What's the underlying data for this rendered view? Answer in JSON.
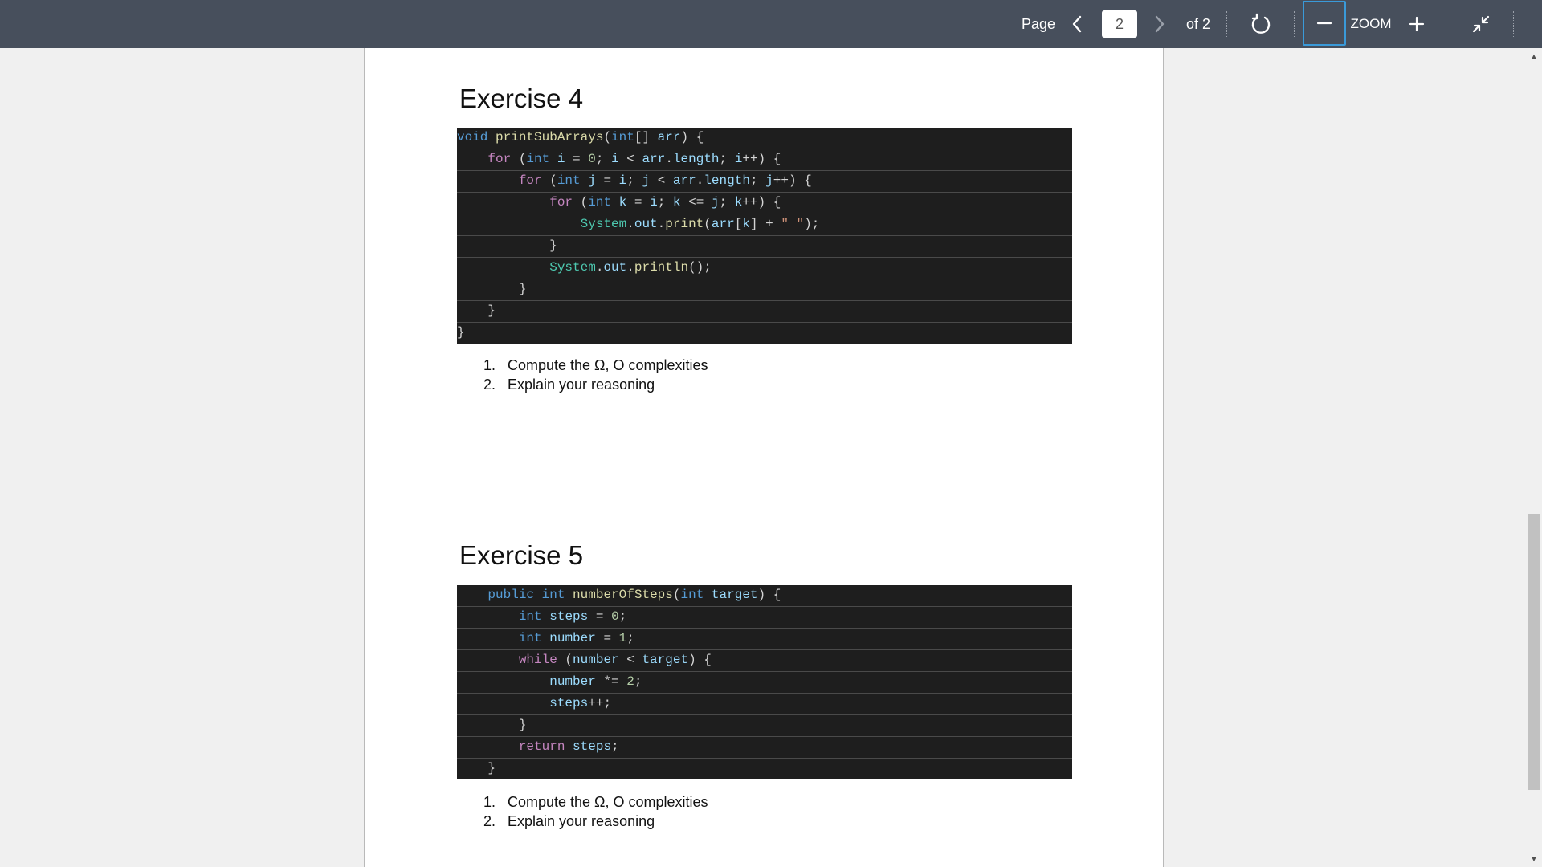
{
  "toolbar": {
    "page_label": "Page",
    "current_page": "2",
    "page_total_label": "of 2",
    "zoom_label": "ZOOM"
  },
  "icons": {
    "prev": "chevron-left-icon",
    "next": "chevron-right-icon",
    "rotate": "rotate-icon",
    "zoom_out": "minus-icon",
    "zoom_in": "plus-icon",
    "collapse": "collapse-arrows-icon"
  },
  "colors": {
    "toolbar_bg": "#474f5c",
    "code_bg": "#1e1e1e",
    "focus_outline": "#3a9ad9"
  },
  "exercises": [
    {
      "title": "Exercise 4",
      "code": [
        [
          [
            "kw",
            "void"
          ],
          [
            "pl",
            " "
          ],
          [
            "fn",
            "printSubArrays"
          ],
          [
            "pl",
            "("
          ],
          [
            "kw",
            "int"
          ],
          [
            "pl",
            "[] "
          ],
          [
            "var",
            "arr"
          ],
          [
            "pl",
            ") {"
          ]
        ],
        [
          [
            "pl",
            "    "
          ],
          [
            "ctl",
            "for"
          ],
          [
            "pl",
            " ("
          ],
          [
            "kw",
            "int"
          ],
          [
            "pl",
            " "
          ],
          [
            "var",
            "i"
          ],
          [
            "pl",
            " = "
          ],
          [
            "num",
            "0"
          ],
          [
            "pl",
            "; "
          ],
          [
            "var",
            "i"
          ],
          [
            "pl",
            " < "
          ],
          [
            "var",
            "arr"
          ],
          [
            "pl",
            "."
          ],
          [
            "var",
            "length"
          ],
          [
            "pl",
            "; "
          ],
          [
            "var",
            "i"
          ],
          [
            "pl",
            "++) {"
          ]
        ],
        [
          [
            "pl",
            "        "
          ],
          [
            "ctl",
            "for"
          ],
          [
            "pl",
            " ("
          ],
          [
            "kw",
            "int"
          ],
          [
            "pl",
            " "
          ],
          [
            "var",
            "j"
          ],
          [
            "pl",
            " = "
          ],
          [
            "var",
            "i"
          ],
          [
            "pl",
            "; "
          ],
          [
            "var",
            "j"
          ],
          [
            "pl",
            " < "
          ],
          [
            "var",
            "arr"
          ],
          [
            "pl",
            "."
          ],
          [
            "var",
            "length"
          ],
          [
            "pl",
            "; "
          ],
          [
            "var",
            "j"
          ],
          [
            "pl",
            "++) {"
          ]
        ],
        [
          [
            "pl",
            "            "
          ],
          [
            "ctl",
            "for"
          ],
          [
            "pl",
            " ("
          ],
          [
            "kw",
            "int"
          ],
          [
            "pl",
            " "
          ],
          [
            "var",
            "k"
          ],
          [
            "pl",
            " = "
          ],
          [
            "var",
            "i"
          ],
          [
            "pl",
            "; "
          ],
          [
            "var",
            "k"
          ],
          [
            "pl",
            " <= "
          ],
          [
            "var",
            "j"
          ],
          [
            "pl",
            "; "
          ],
          [
            "var",
            "k"
          ],
          [
            "pl",
            "++) {"
          ]
        ],
        [
          [
            "pl",
            "                "
          ],
          [
            "typ",
            "System"
          ],
          [
            "pl",
            "."
          ],
          [
            "var",
            "out"
          ],
          [
            "pl",
            "."
          ],
          [
            "fn",
            "print"
          ],
          [
            "pl",
            "("
          ],
          [
            "var",
            "arr"
          ],
          [
            "pl",
            "["
          ],
          [
            "var",
            "k"
          ],
          [
            "pl",
            "] + "
          ],
          [
            "str",
            "\" \""
          ],
          [
            "pl",
            ");"
          ]
        ],
        [
          [
            "pl",
            "            }"
          ]
        ],
        [
          [
            "pl",
            "            "
          ],
          [
            "typ",
            "System"
          ],
          [
            "pl",
            "."
          ],
          [
            "var",
            "out"
          ],
          [
            "pl",
            "."
          ],
          [
            "fn",
            "println"
          ],
          [
            "pl",
            "();"
          ]
        ],
        [
          [
            "pl",
            "        }"
          ]
        ],
        [
          [
            "pl",
            "    }"
          ]
        ],
        [
          [
            "pl",
            "}"
          ]
        ]
      ],
      "tasks": [
        {
          "number": "1.",
          "text": "Compute the Ω, O complexities"
        },
        {
          "number": "2.",
          "text": "Explain your reasoning"
        }
      ]
    },
    {
      "title": "Exercise 5",
      "code": [
        [
          [
            "pl",
            "    "
          ],
          [
            "kw",
            "public"
          ],
          [
            "pl",
            " "
          ],
          [
            "kw",
            "int"
          ],
          [
            "pl",
            " "
          ],
          [
            "fn",
            "numberOfSteps"
          ],
          [
            "pl",
            "("
          ],
          [
            "kw",
            "int"
          ],
          [
            "pl",
            " "
          ],
          [
            "var",
            "target"
          ],
          [
            "pl",
            ") {"
          ]
        ],
        [
          [
            "pl",
            "        "
          ],
          [
            "kw",
            "int"
          ],
          [
            "pl",
            " "
          ],
          [
            "var",
            "steps"
          ],
          [
            "pl",
            " = "
          ],
          [
            "num",
            "0"
          ],
          [
            "pl",
            ";"
          ]
        ],
        [
          [
            "pl",
            "        "
          ],
          [
            "kw",
            "int"
          ],
          [
            "pl",
            " "
          ],
          [
            "var",
            "number"
          ],
          [
            "pl",
            " = "
          ],
          [
            "num",
            "1"
          ],
          [
            "pl",
            ";"
          ]
        ],
        [
          [
            "pl",
            "        "
          ],
          [
            "ctl",
            "while"
          ],
          [
            "pl",
            " ("
          ],
          [
            "var",
            "number"
          ],
          [
            "pl",
            " < "
          ],
          [
            "var",
            "target"
          ],
          [
            "pl",
            ") {"
          ]
        ],
        [
          [
            "pl",
            "            "
          ],
          [
            "var",
            "number"
          ],
          [
            "pl",
            " *= "
          ],
          [
            "num",
            "2"
          ],
          [
            "pl",
            ";"
          ]
        ],
        [
          [
            "pl",
            "            "
          ],
          [
            "var",
            "steps"
          ],
          [
            "pl",
            "++;"
          ]
        ],
        [
          [
            "pl",
            "        }"
          ]
        ],
        [
          [
            "pl",
            "        "
          ],
          [
            "ctl",
            "return"
          ],
          [
            "pl",
            " "
          ],
          [
            "var",
            "steps"
          ],
          [
            "pl",
            ";"
          ]
        ],
        [
          [
            "pl",
            "    }"
          ]
        ]
      ],
      "tasks": [
        {
          "number": "1.",
          "text": "Compute the Ω, O complexities"
        },
        {
          "number": "2.",
          "text": "Explain your reasoning"
        }
      ]
    }
  ]
}
